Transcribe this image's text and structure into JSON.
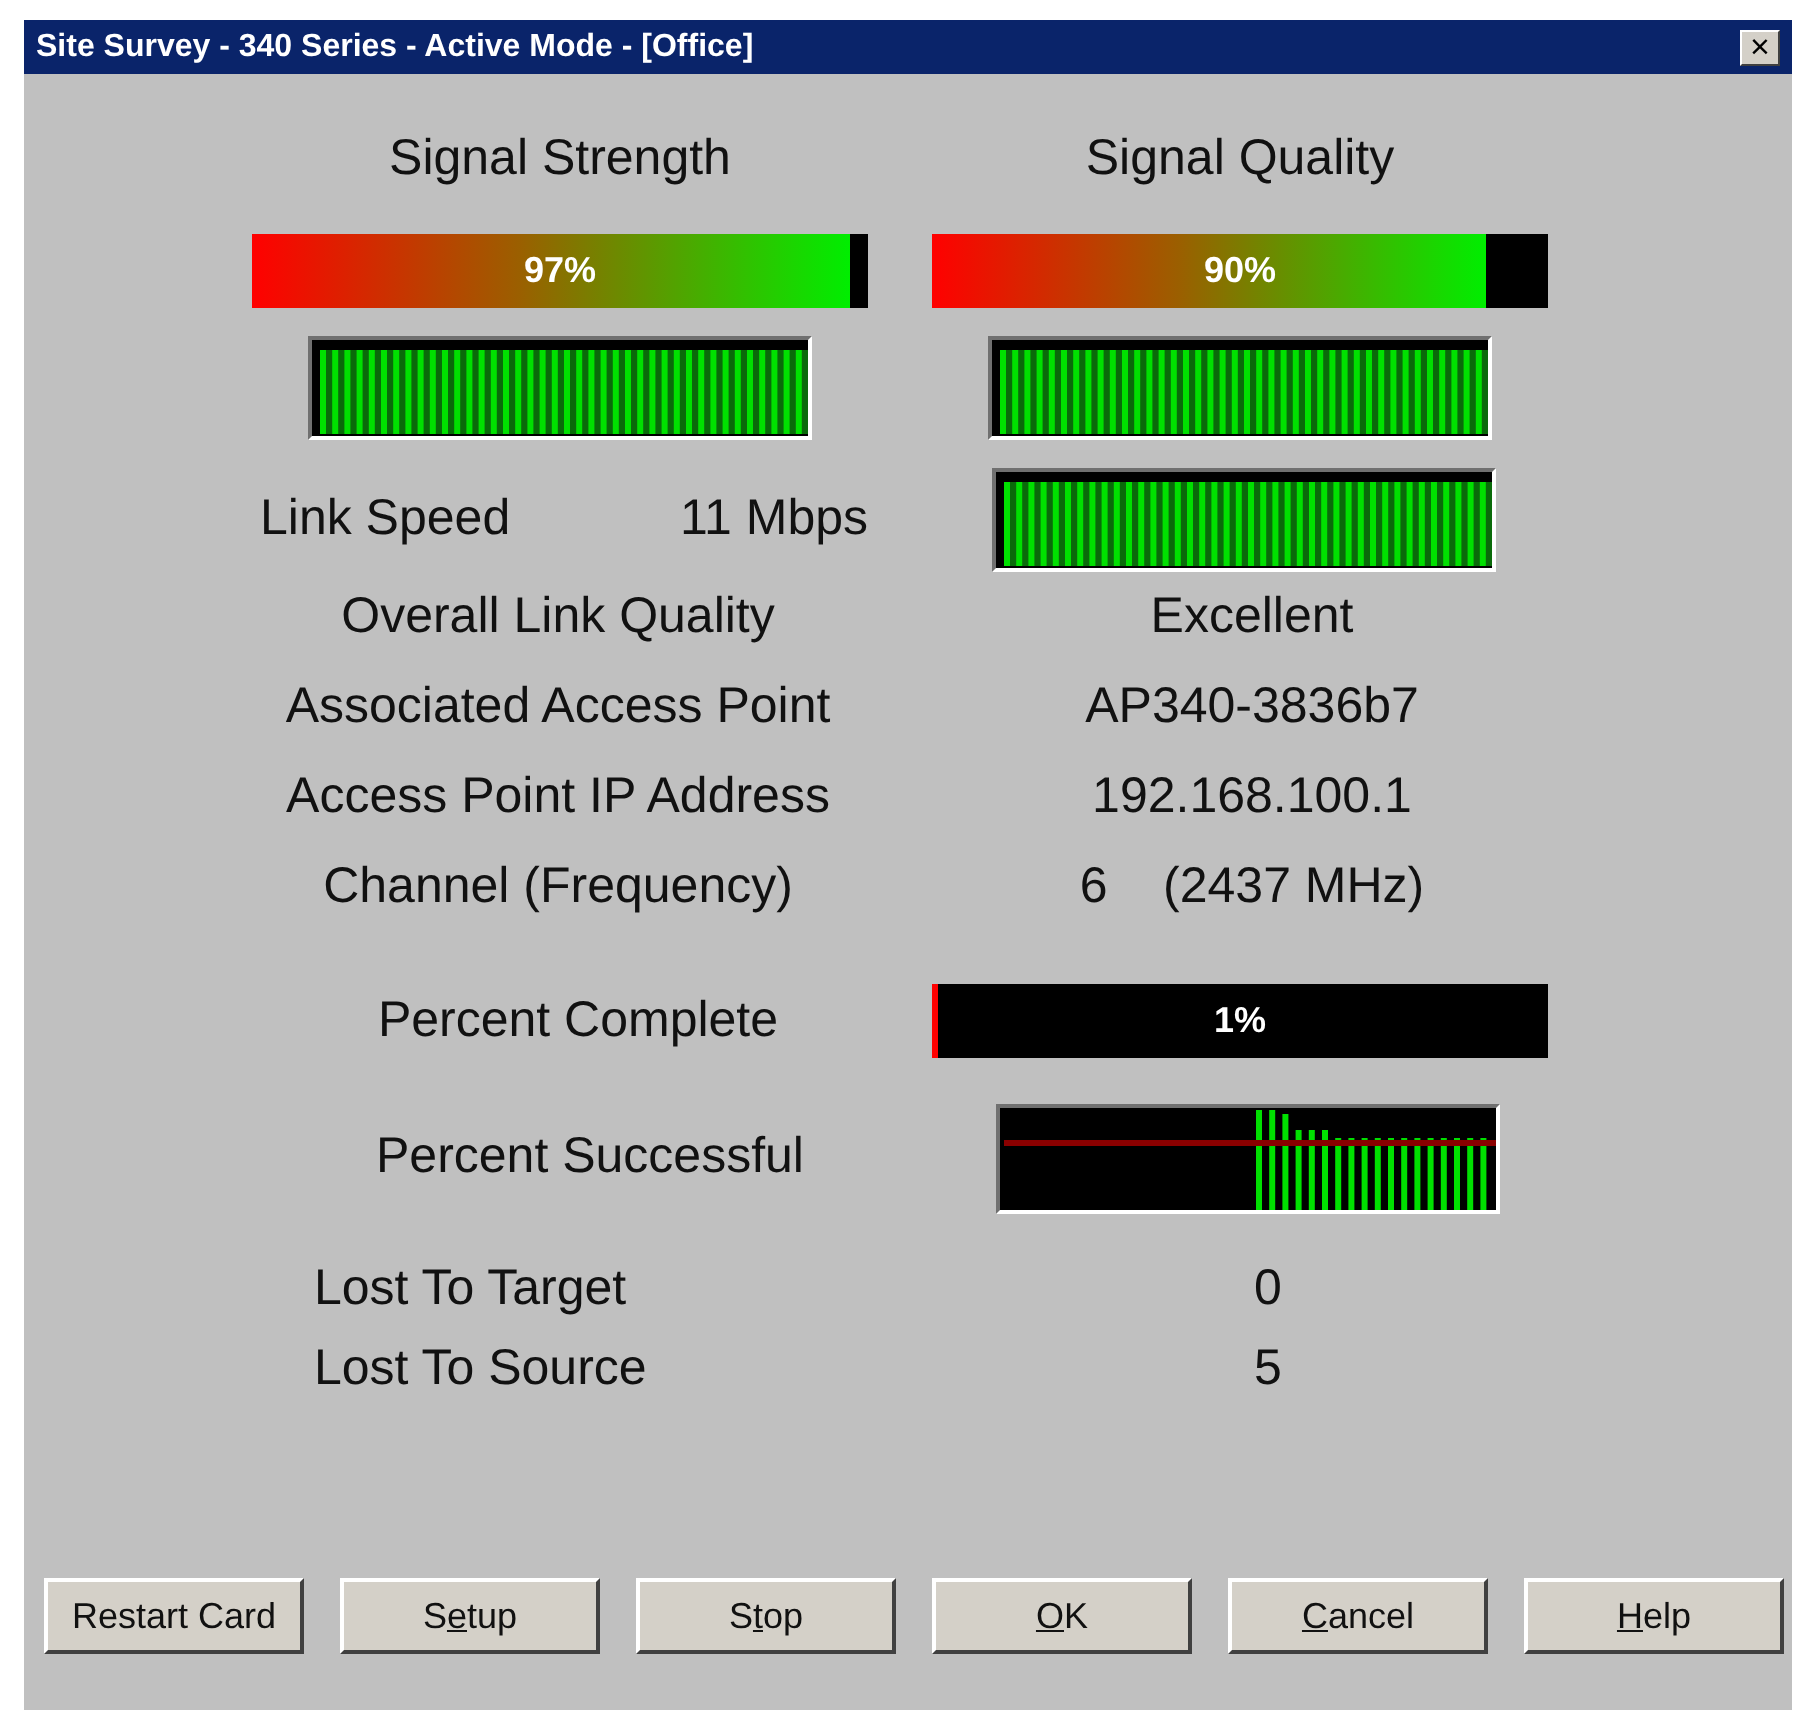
{
  "window": {
    "title": "Site Survey - 340 Series - Active Mode - [Office]",
    "close": "×"
  },
  "signal": [
    {
      "heading": "Signal Strength",
      "level": 0.97,
      "reading": "97%"
    },
    {
      "heading": "Signal Quality",
      "level": 0.9,
      "reading": "90%"
    }
  ],
  "link_speed": {
    "label": "Link Speed",
    "value": "11 Mbps"
  },
  "details": [
    {
      "label": "Overall Link Quality",
      "value": "Excellent"
    },
    {
      "label": "Associated Access Point",
      "value": "AP340-3836b7"
    },
    {
      "label": "Access Point IP Address",
      "value": "192.168.100.1"
    },
    {
      "label": "Channel (Frequency)",
      "value": "6    (2437 MHz)"
    }
  ],
  "percent_complete": {
    "label": "Percent Complete",
    "level": 0.01,
    "reading": "1%"
  },
  "percent_successful": {
    "label": "Percent Successful"
  },
  "lost": [
    {
      "label": "Lost To Target",
      "value": "0"
    },
    {
      "label": "Lost To Source",
      "value": "5"
    }
  ],
  "buttons": [
    {
      "before": "Restart Card"
    },
    {
      "before": "S",
      "key": "e",
      "after": "tup"
    },
    {
      "before": "S",
      "key": "t",
      "after": "op"
    },
    {
      "key": "O",
      "after": "K"
    },
    {
      "key": "C",
      "after": "ancel"
    },
    {
      "key": "H",
      "after": "elp"
    }
  ]
}
